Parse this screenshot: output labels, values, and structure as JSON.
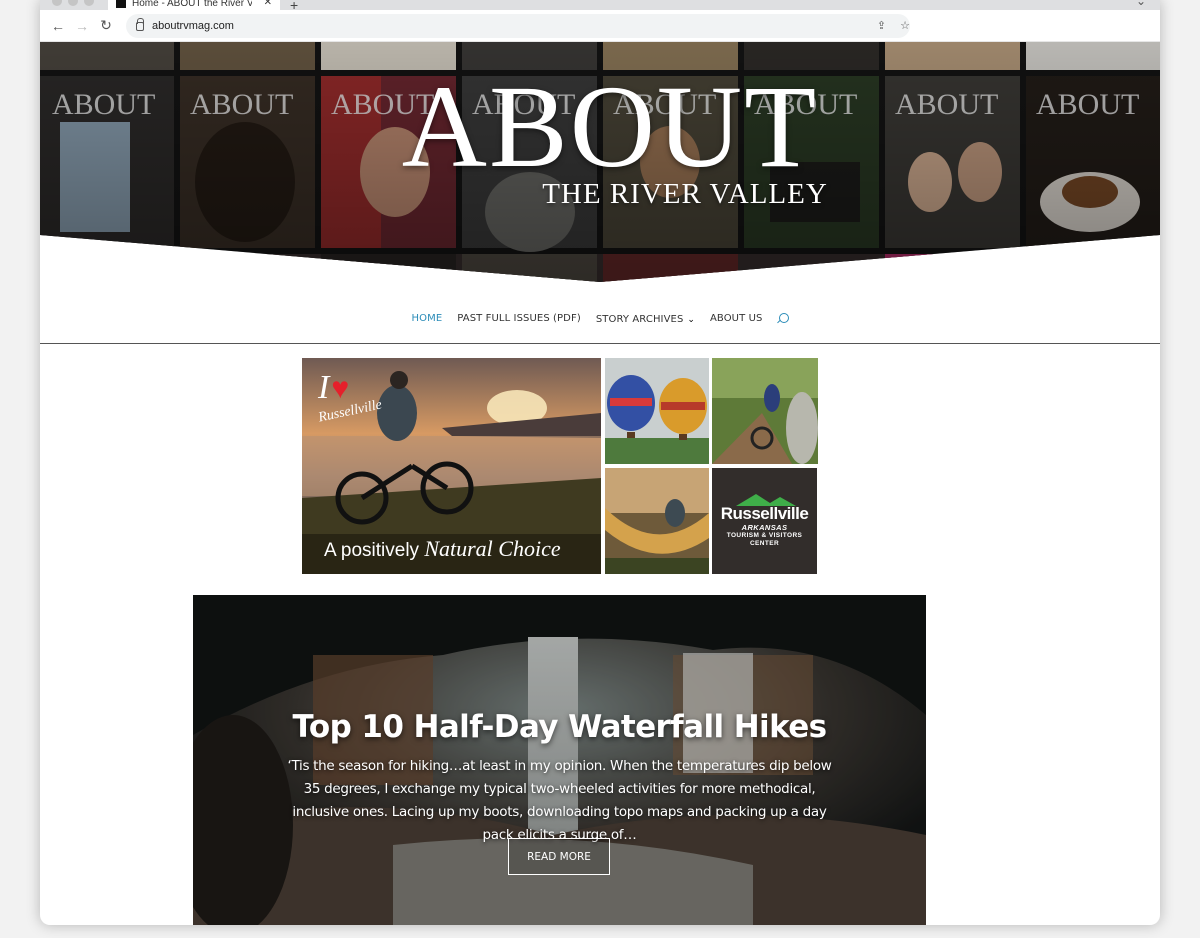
{
  "browser": {
    "tab_title": "Home - ABOUT the River Valley",
    "tab_close": "✕",
    "new_tab": "+",
    "url": "aboutrvmag.com",
    "icons": [
      "back-arrow-icon",
      "forward-arrow-icon",
      "reload-icon",
      "lock-icon",
      "share-icon",
      "star-icon"
    ]
  },
  "hero": {
    "logo_main": "ABOUT",
    "logo_sub": "THE RIVER VALLEY"
  },
  "nav": {
    "items": [
      {
        "label": "HOME",
        "active": true
      },
      {
        "label": "PAST FULL ISSUES (PDF)"
      },
      {
        "label": "STORY ARCHIVES"
      },
      {
        "label": "ABOUT US"
      }
    ],
    "search_icon": "search-icon",
    "accent_color": "#2b8cb8"
  },
  "ad": {
    "tag_i": "I",
    "tag_heart": "♥",
    "tag_city": "Russellville",
    "headline_plain": "A positively ",
    "headline_script": "Natural Choice",
    "brand_name": "Russellville",
    "brand_state": "ARKANSAS",
    "brand_sub": "TOURISM & VISITORS CENTER"
  },
  "feature": {
    "title": "Top 10 Half-Day Waterfall Hikes",
    "excerpt": "‘Tis the season for hiking…at least in my opinion. When the temperatures dip below 35 degrees, I exchange my typical two-wheeled activities for more methodical, inclusive ones. Lacing up my boots, downloading topo maps and packing up a day pack elicits a surge of…",
    "button": "READ MORE"
  }
}
